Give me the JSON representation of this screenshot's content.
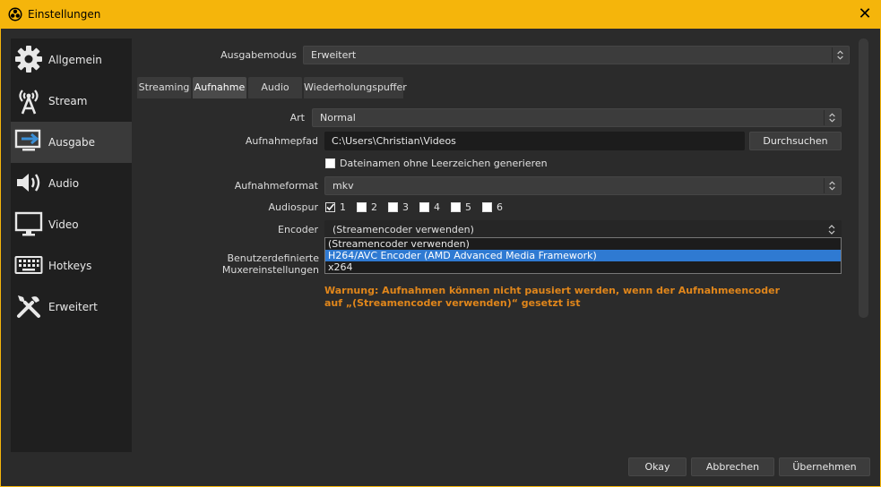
{
  "window": {
    "title": "Einstellungen",
    "close_glyph": "✕"
  },
  "sidebar": {
    "items": [
      {
        "label": "Allgemein",
        "icon": "gear-icon"
      },
      {
        "label": "Stream",
        "icon": "broadcast-tower-icon"
      },
      {
        "label": "Ausgabe",
        "icon": "output-icon",
        "active": true
      },
      {
        "label": "Audio",
        "icon": "speaker-icon"
      },
      {
        "label": "Video",
        "icon": "monitor-icon"
      },
      {
        "label": "Hotkeys",
        "icon": "keyboard-icon"
      },
      {
        "label": "Erweitert",
        "icon": "tools-icon"
      }
    ]
  },
  "output_mode": {
    "label": "Ausgabemodus",
    "value": "Erweitert"
  },
  "tabs": [
    "Streaming",
    "Aufnahme",
    "Audio",
    "Wiederholungspuffer"
  ],
  "active_tab": "Aufnahme",
  "recording": {
    "type": {
      "label": "Art",
      "value": "Normal"
    },
    "path": {
      "label": "Aufnahmepfad",
      "value": "C:\\Users\\Christian\\Videos",
      "browse": "Durchsuchen"
    },
    "no_spaces": {
      "label": "Dateinamen ohne Leerzeichen generieren",
      "checked": false
    },
    "format": {
      "label": "Aufnahmeformat",
      "value": "mkv"
    },
    "tracks": {
      "label": "Audiospur",
      "items": [
        {
          "label": "1",
          "checked": true
        },
        {
          "label": "2",
          "checked": false
        },
        {
          "label": "3",
          "checked": false
        },
        {
          "label": "4",
          "checked": false
        },
        {
          "label": "5",
          "checked": false
        },
        {
          "label": "6",
          "checked": false
        }
      ]
    },
    "encoder": {
      "label": "Encoder",
      "value": "(Streamencoder verwenden)",
      "options": [
        "(Streamencoder verwenden)",
        "H264/AVC Encoder (AMD Advanced Media Framework)",
        "x264"
      ],
      "highlighted": "H264/AVC Encoder (AMD Advanced Media Framework)"
    },
    "muxer": {
      "label": "Benutzerdefinierte Muxereinstellungen"
    },
    "warning": "Warnung: Aufnahmen können nicht pausiert werden, wenn der Aufnahmeencoder auf „(Streamencoder verwenden)“ gesetzt ist"
  },
  "footer": {
    "ok": "Okay",
    "cancel": "Abbrechen",
    "apply": "Übernehmen"
  },
  "colors": {
    "accent": "#f5b50b",
    "selection": "#2f7ad2",
    "warning": "#e0861b"
  }
}
